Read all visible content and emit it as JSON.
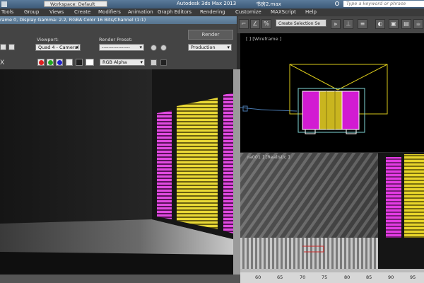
{
  "titlebar": {
    "workspace": "Workspace: Default",
    "app_name": "Autodesk 3ds Max 2013",
    "file_name": "书房2.max",
    "search_placeholder": "Type a keyword or phrase"
  },
  "menu": [
    "Tools",
    "Group",
    "Views",
    "Create",
    "Modifiers",
    "Animation",
    "Graph Editors",
    "Rendering",
    "Customize",
    "MAXScript",
    "Help"
  ],
  "render_frame": {
    "title": "rame 0, Display Gamma: 2.2, RGBA Color 16 Bits/Channel (1:1)",
    "viewport_label": "Viewport:",
    "viewport_value": "Quad 4 - Camera(",
    "preset_label": "Render Preset:",
    "preset_value": "-----------------",
    "render_button": "Render",
    "production_value": "Production",
    "channel_value": "RGB Alpha",
    "close_icon_text": "X"
  },
  "toolbar": {
    "selection_set": "Create Selection Se"
  },
  "viewports": {
    "top_label": "[ ] [Wireframe ]",
    "persp_label": "ra001 ] [Realistic ]"
  },
  "timeline": {
    "ticks": [
      "60",
      "65",
      "70",
      "75",
      "80",
      "85",
      "90",
      "95"
    ]
  },
  "colors": {
    "magenta": "#d21bd2",
    "yellow": "#d6c620",
    "wire_yellow": "#d8c81a",
    "wire_cyan": "#7fd6d6"
  }
}
